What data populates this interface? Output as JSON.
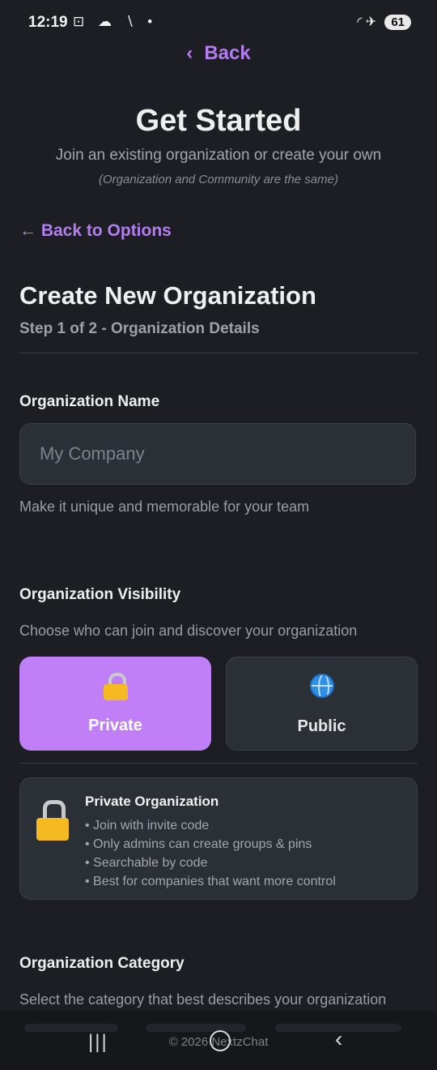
{
  "status_bar": {
    "time": "12:19",
    "left_icons": "⊡ ☁ ∖ •",
    "right_icons": "◜ ✈",
    "battery": "61"
  },
  "top_nav": {
    "back_label": "Back",
    "chevron": "‹"
  },
  "header": {
    "title": "Get Started",
    "subtitle": "Join an existing organization or create your own",
    "note": "(Organization and Community are the same)"
  },
  "back_to_options": "← Back to Options",
  "create": {
    "heading": "Create New Organization",
    "step": "Step 1 of 2 - Organization Details"
  },
  "org_name": {
    "label": "Organization Name",
    "placeholder": "My Company",
    "value": "",
    "hint": "Make it unique and memorable for your team"
  },
  "visibility": {
    "label": "Organization Visibility",
    "hint": "Choose who can join and discover your organization",
    "options": [
      {
        "label": "Private",
        "icon": "lock-icon",
        "selected": true
      },
      {
        "label": "Public",
        "icon": "globe-icon",
        "selected": false
      }
    ],
    "info": {
      "title": "Private Organization",
      "points": [
        "• Join with invite code",
        "• Only admins can create groups & pins",
        "• Searchable by code",
        "• Best for companies that want more control"
      ]
    }
  },
  "category": {
    "label": "Organization Category",
    "hint": "Select the category that best describes your organization"
  },
  "footer": {
    "copyright": "© 2026 NextzChat"
  },
  "colors": {
    "accent": "#b37df0",
    "selected": "#c17ff7",
    "background": "#1c1e23",
    "card": "#2b2f36"
  }
}
